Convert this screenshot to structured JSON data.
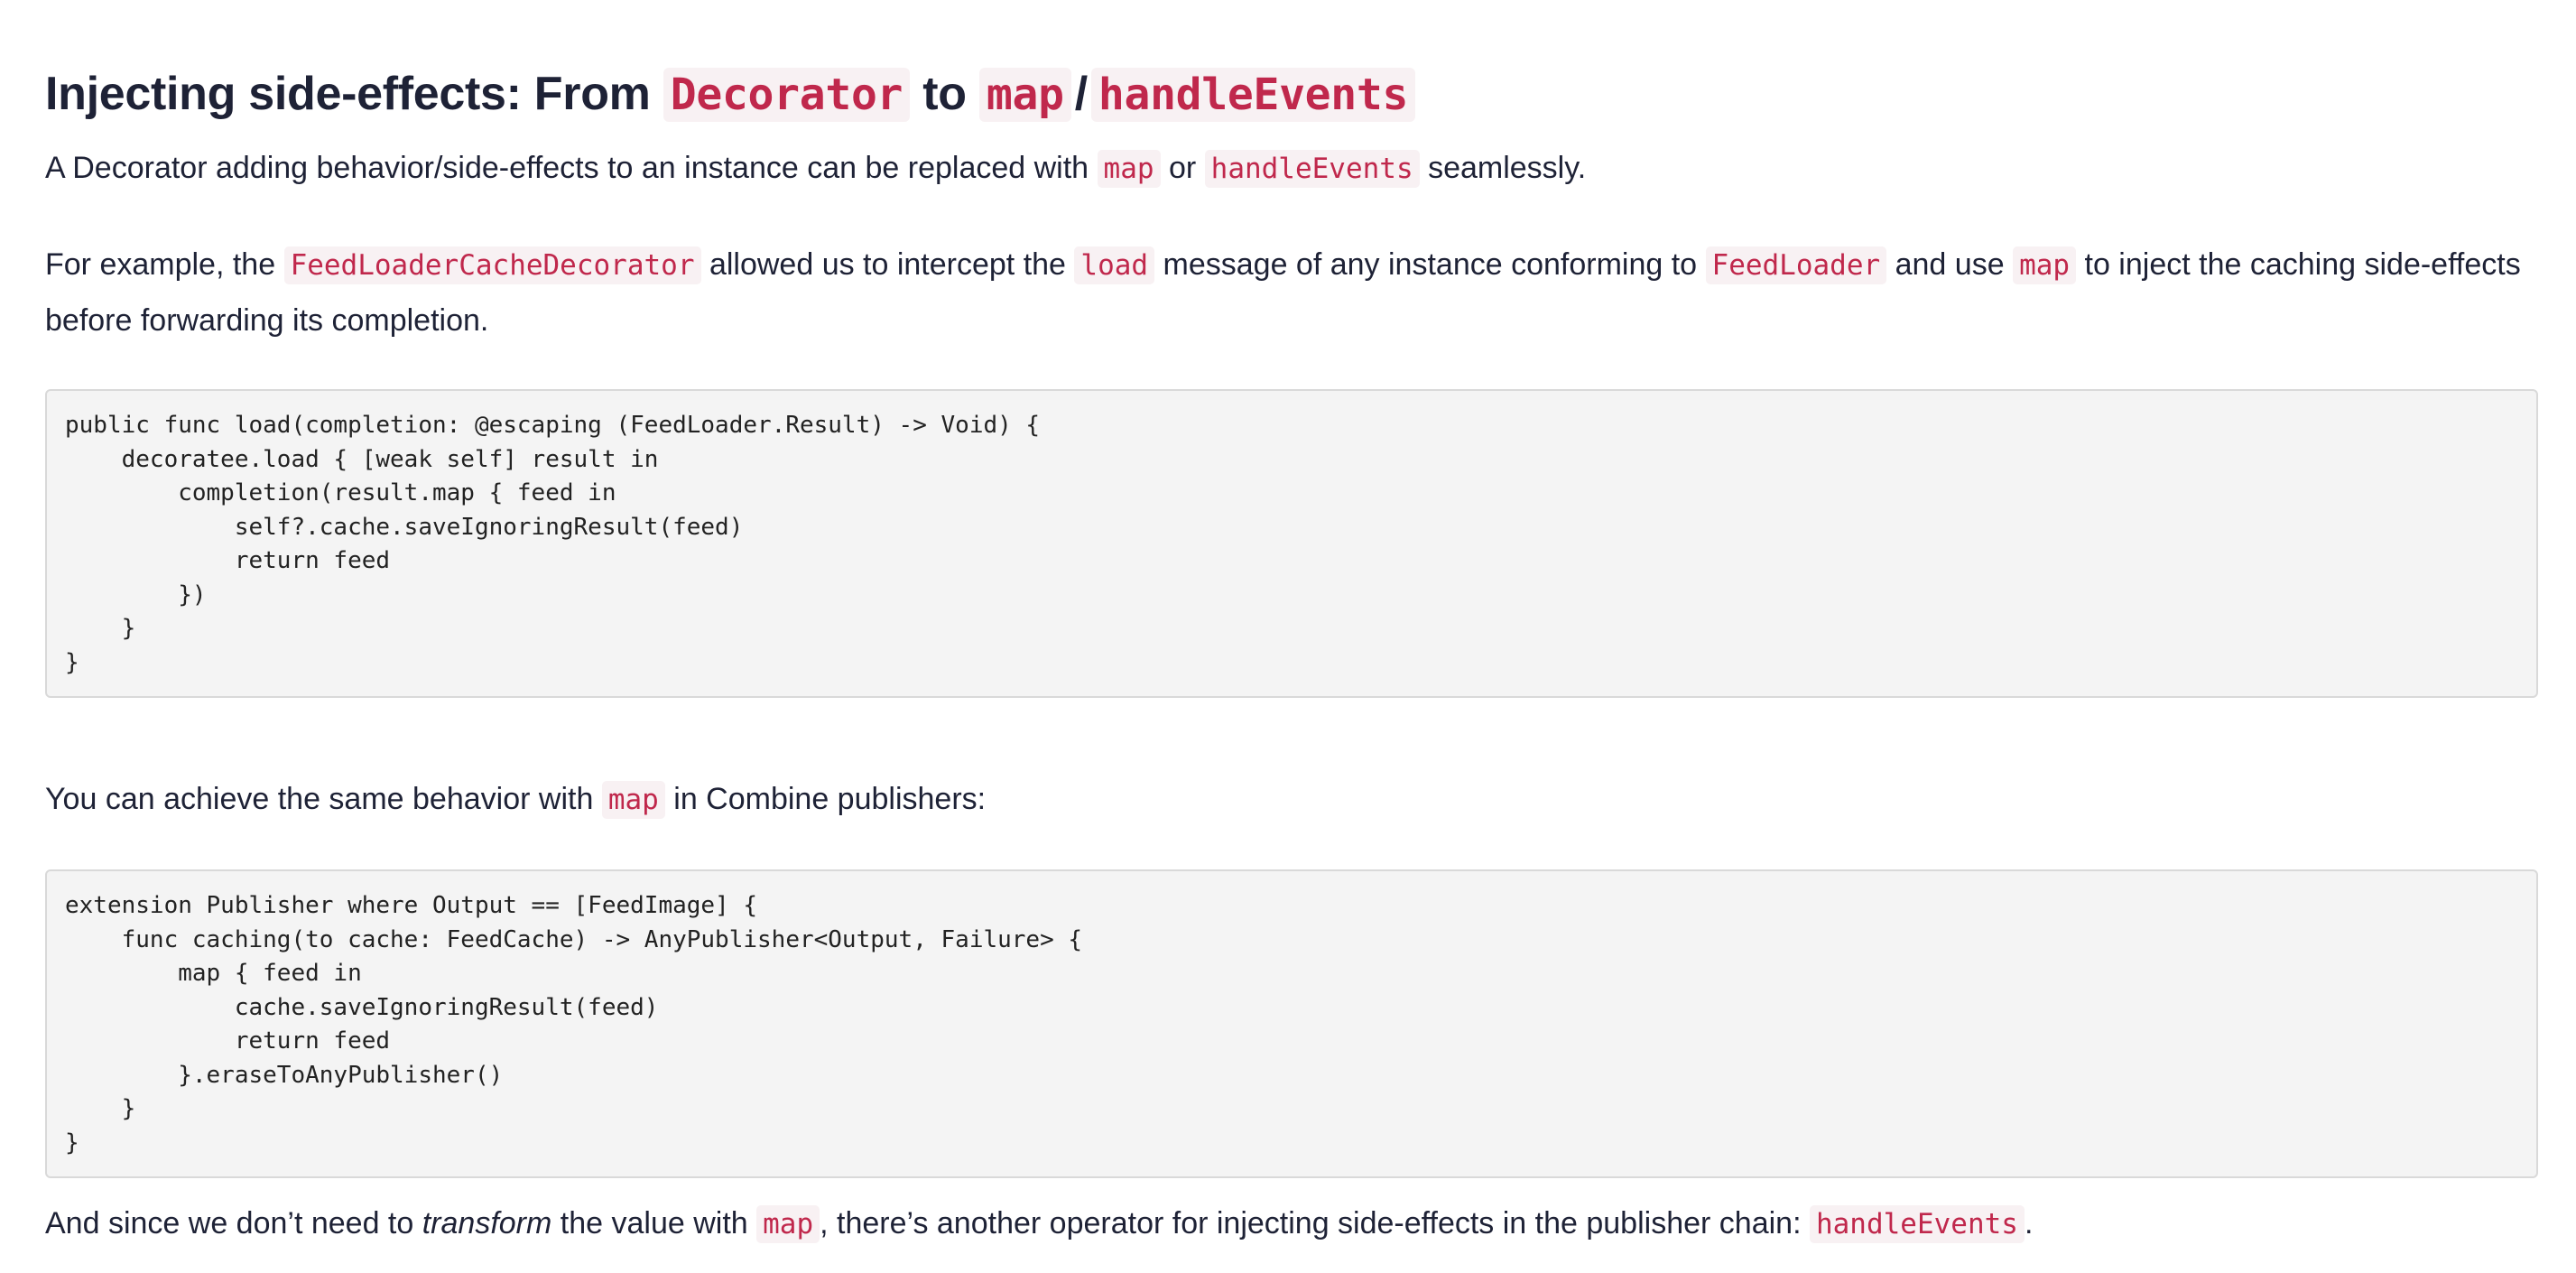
{
  "heading": {
    "prefix": "Injecting side-effects: From ",
    "code1": "Decorator",
    "middle": " to ",
    "code2": "map",
    "slash": "/",
    "code3": "handleEvents"
  },
  "para1": {
    "t1": "A Decorator adding behavior/side-effects to an instance can be replaced with ",
    "c1": "map",
    "t2": " or ",
    "c2": "handleEvents",
    "t3": " seamlessly."
  },
  "para2": {
    "t1": "For example, the ",
    "c1": "FeedLoaderCacheDecorator",
    "t2": " allowed us to intercept the ",
    "c2": "load",
    "t3": " message of any instance conforming to ",
    "c3": "FeedLoader",
    "t4": " and use ",
    "c4": "map",
    "t5": " to inject the caching side-effects before forwarding its completion."
  },
  "code_block_1": "public func load(completion: @escaping (FeedLoader.Result) -> Void) {\n    decoratee.load { [weak self] result in\n        completion(result.map { feed in\n            self?.cache.saveIgnoringResult(feed)\n            return feed\n        })\n    }\n}",
  "para3": {
    "t1": "You can achieve the same behavior with ",
    "c1": "map",
    "t2": " in Combine publishers:"
  },
  "code_block_2": "extension Publisher where Output == [FeedImage] {\n    func caching(to cache: FeedCache) -> AnyPublisher<Output, Failure> {\n        map { feed in\n            cache.saveIgnoringResult(feed)\n            return feed\n        }.eraseToAnyPublisher()\n    }\n}",
  "para4": {
    "t1": "And since we don’t need to ",
    "em": "transform",
    "t2": " the value with ",
    "c1": "map",
    "t3": ", there’s another operator for injecting side-effects in the publisher chain: ",
    "c2": "handleEvents",
    "t4": "."
  }
}
